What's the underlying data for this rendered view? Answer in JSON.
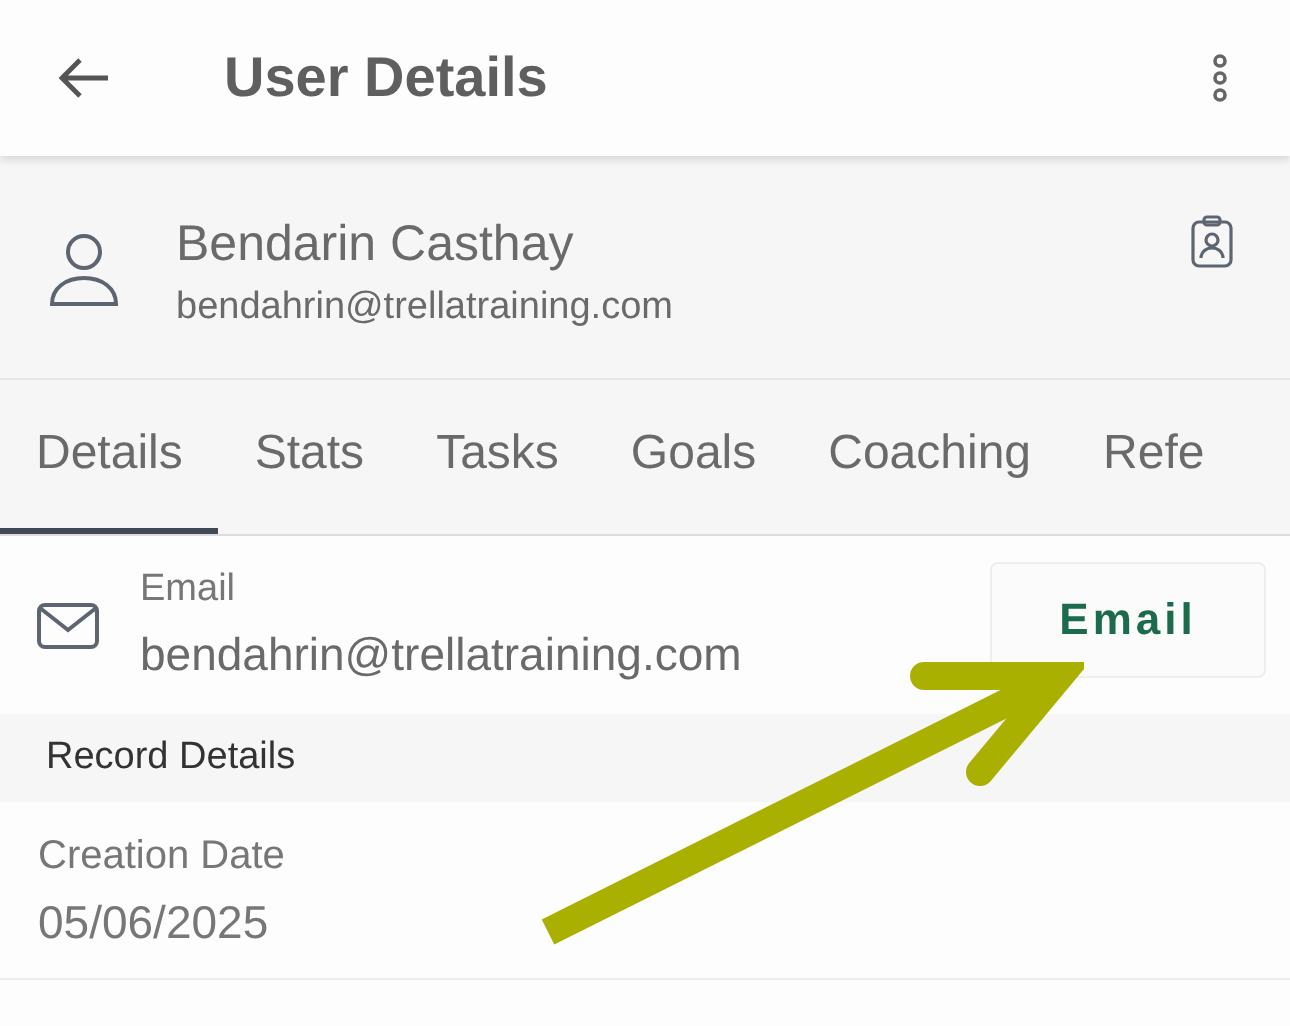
{
  "app_bar": {
    "title": "User Details"
  },
  "user": {
    "name": "Bendarin Casthay",
    "email": "bendahrin@trellatraining.com"
  },
  "tabs": [
    {
      "label": "Details",
      "selected": true
    },
    {
      "label": "Stats",
      "selected": false
    },
    {
      "label": "Tasks",
      "selected": false
    },
    {
      "label": "Goals",
      "selected": false
    },
    {
      "label": "Coaching",
      "selected": false
    },
    {
      "label": "Refe",
      "selected": false
    }
  ],
  "email_row": {
    "label": "Email",
    "value": "bendahrin@trellatraining.com",
    "button": "Email"
  },
  "section": {
    "title": "Record Details"
  },
  "fields": [
    {
      "label": "Creation Date",
      "value": "05/06/2025"
    }
  ]
}
